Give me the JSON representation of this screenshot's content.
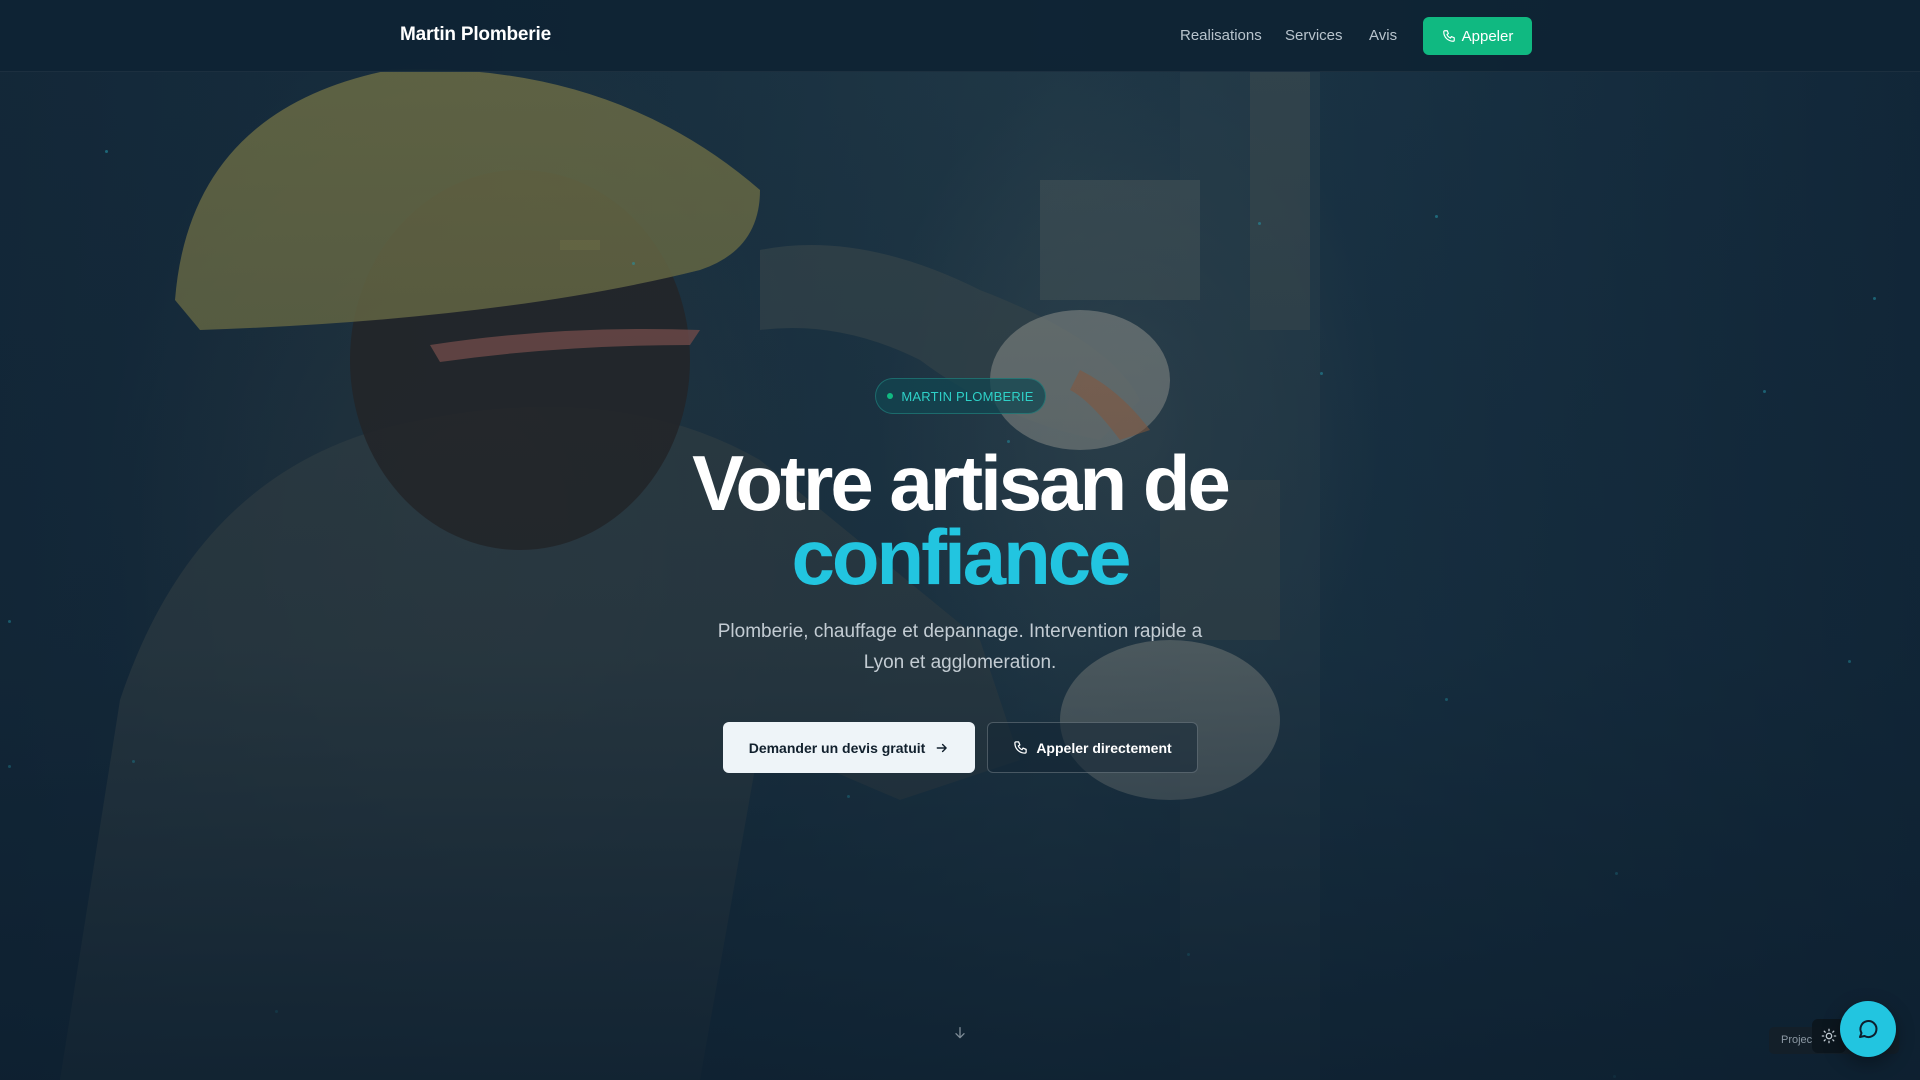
{
  "nav": {
    "brand": "Martin Plomberie",
    "links": [
      "Realisations",
      "Services",
      "Avis"
    ],
    "cta_label": "Appeler"
  },
  "hero": {
    "badge": "MARTIN PLOMBERIE",
    "title_line1": "Votre artisan de",
    "title_line2": "confiance",
    "subtitle": "Plomberie, chauffage et depannage. Intervention rapide a Lyon et agglomeration.",
    "primary_button": "Demander un devis gratuit",
    "secondary_button": "Appeler directement"
  },
  "widgets": {
    "project_label": "Projec"
  },
  "colors": {
    "accent": "#22c5e0",
    "cta_green": "#10b981",
    "nav_bg": "#0f2334"
  },
  "icons": [
    "phone-icon",
    "arrow-right-icon",
    "arrow-down-icon",
    "sun-icon",
    "chat-icon"
  ]
}
